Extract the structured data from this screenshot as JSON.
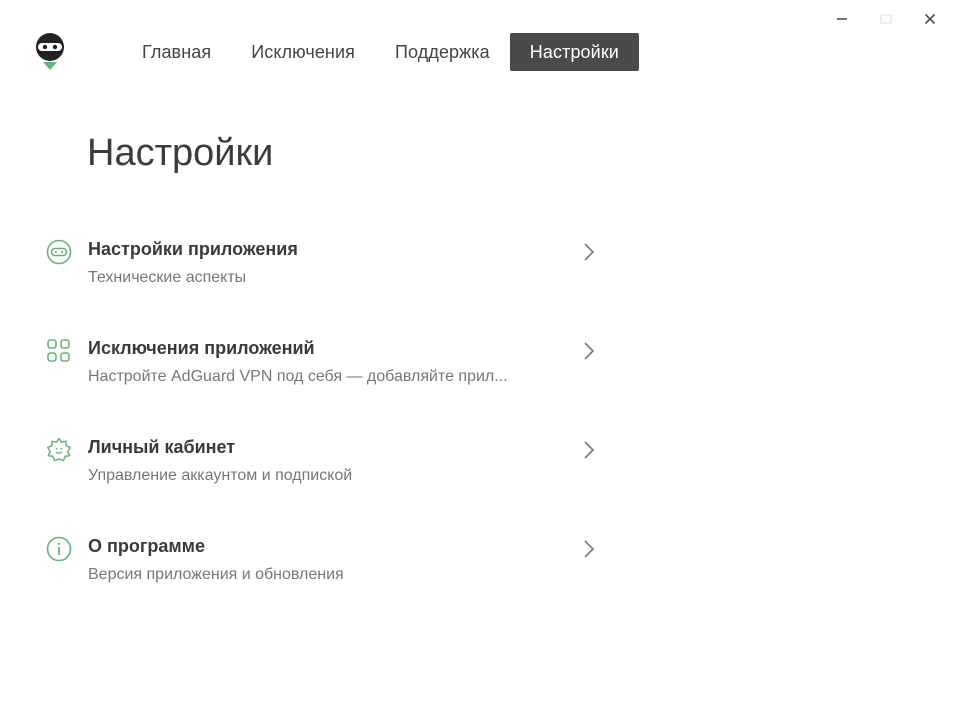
{
  "nav": {
    "items": [
      {
        "label": "Главная",
        "active": false
      },
      {
        "label": "Исключения",
        "active": false
      },
      {
        "label": "Поддержка",
        "active": false
      },
      {
        "label": "Настройки",
        "active": true
      }
    ]
  },
  "page": {
    "title": "Настройки"
  },
  "settings": {
    "items": [
      {
        "title": "Настройки приложения",
        "subtitle": "Технические аспекты",
        "icon": "app-settings-icon"
      },
      {
        "title": "Исключения приложений",
        "subtitle": "Настройте AdGuard VPN под себя — добавляйте прил...",
        "icon": "app-grid-icon"
      },
      {
        "title": "Личный кабинет",
        "subtitle": "Управление аккаунтом и подпиской",
        "icon": "account-badge-icon"
      },
      {
        "title": "О программе",
        "subtitle": "Версия приложения и обновления",
        "icon": "info-icon"
      }
    ]
  },
  "colors": {
    "accent": "#67b279",
    "nav_active_bg": "#4a4a4a",
    "title_text": "#3c3c3c",
    "subtitle_text": "#777777"
  }
}
